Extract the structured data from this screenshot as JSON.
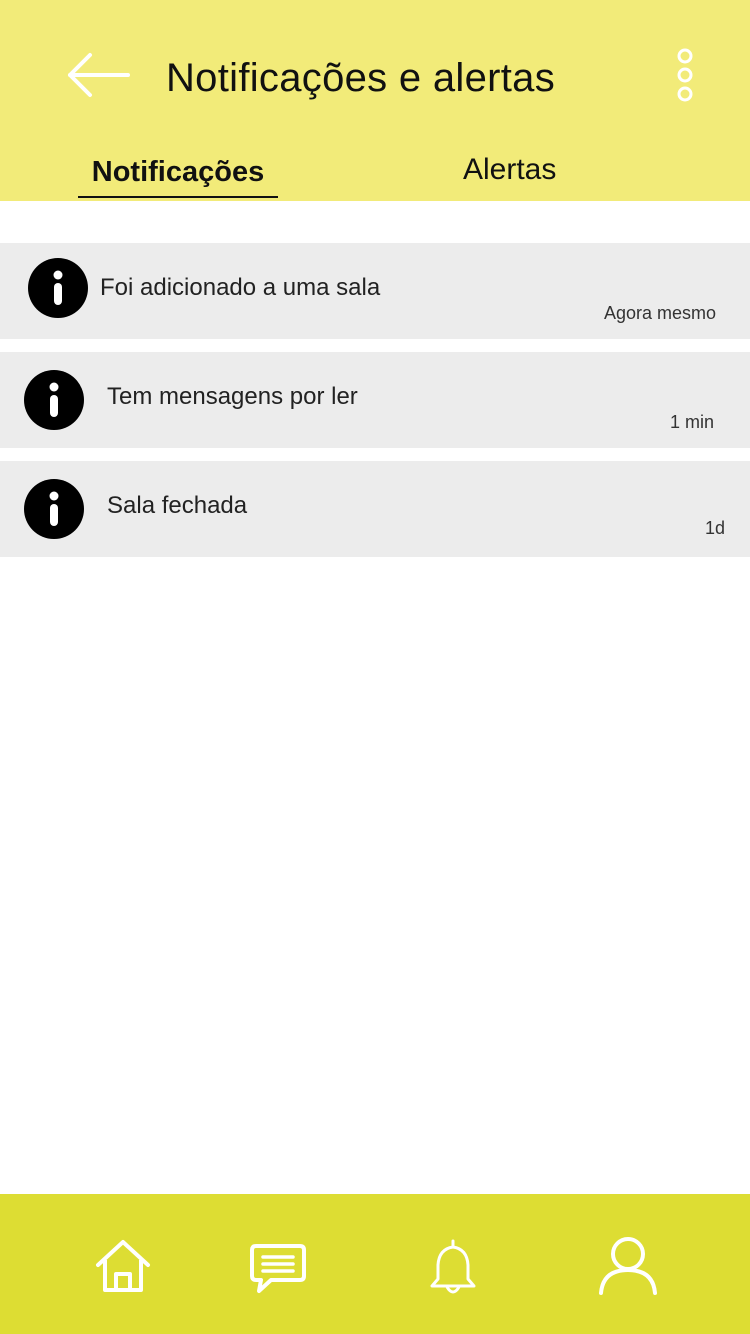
{
  "header": {
    "title": "Notificações e alertas",
    "back_icon": "arrow-left-icon",
    "more_icon": "vertical-dots-icon",
    "background": "#f2eb79"
  },
  "tabs": [
    {
      "label": "Notificações",
      "active": true
    },
    {
      "label": "Alertas",
      "active": false
    }
  ],
  "notifications": [
    {
      "message": "Foi adicionado a uma sala",
      "time": "Agora mesmo",
      "icon": "info-icon"
    },
    {
      "message": "Tem mensagens por ler",
      "time": "1 min",
      "icon": "info-icon"
    },
    {
      "message": "Sala fechada",
      "time": "1d",
      "icon": "info-icon"
    }
  ],
  "bottom_nav": {
    "background": "#dddd33",
    "items": [
      {
        "icon": "home-icon"
      },
      {
        "icon": "chat-icon"
      },
      {
        "icon": "bell-icon"
      },
      {
        "icon": "user-icon"
      }
    ]
  }
}
